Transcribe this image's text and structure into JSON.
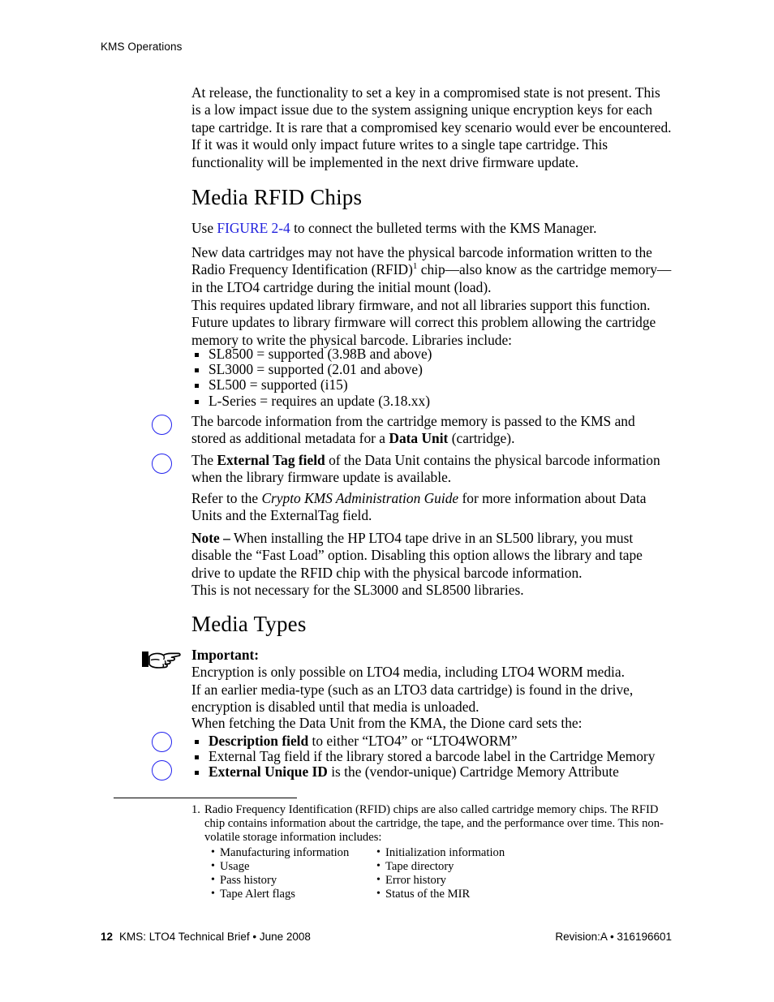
{
  "header": {
    "running_head": "KMS Operations"
  },
  "intro_paragraph": "At release, the functionality to set a key in a compromised state is not present. This is a low impact issue due to the system assigning unique encryption keys for each tape cartridge. It is rare that a compromised key scenario would ever be encountered. If it was it would only impact future writes to a single tape cartridge. This functionality will be implemented in the next drive firmware update.",
  "section_rfid": {
    "heading": "Media RFID Chips",
    "use_figure_prefix": "Use ",
    "figure_link": "FIGURE 2-4",
    "use_figure_suffix": " to connect the bulleted terms with the KMS Manager.",
    "para_new_cartridges_1": "New data cartridges may not have the physical barcode information written to the Radio Frequency Identification (RFID)",
    "footnote_marker": "1",
    "para_new_cartridges_2": " chip—also know as the cartridge memory—in the LTO4 cartridge during the initial mount (load).",
    "para_firmware": "This requires updated library firmware, and not all libraries support this function. Future updates to library firmware will correct this problem allowing the cartridge memory to write the physical barcode.  Libraries include:",
    "library_bullets": [
      "SL8500 = supported (3.98B and above)",
      "SL3000 = supported (2.01 and above)",
      "SL500 = supported (i15)",
      "L-Series = requires an update (3.18.xx)"
    ],
    "annotated_1_part1": "The barcode information from the cartridge memory is passed to the KMS and stored as additional metadata for a ",
    "annotated_1_bold": "Data Unit",
    "annotated_1_part2": " (cartridge).",
    "annotated_2_part1": "The ",
    "annotated_2_bold": "External Tag field",
    "annotated_2_part2": " of the Data Unit contains the physical barcode information when the library firmware update is available.",
    "refer_part1": "Refer to the ",
    "refer_italic": "Crypto KMS Administration Guide",
    "refer_part2": " for more information about Data Units and the ExternalTag field.",
    "note_label": "Note –",
    "note_body": " When installing the HP LTO4 tape drive in an SL500 library, you must disable the “Fast Load” option. Disabling this option allows the library and tape drive to update the RFID chip with the physical barcode information.",
    "note_body_line2": "This is not necessary for the SL3000 and SL8500 libraries."
  },
  "section_media_types": {
    "heading": "Media Types",
    "important_label": "Important:",
    "important_line_1": "Encryption is only possible on LTO4 media, including LTO4 WORM media.",
    "important_line_2": "If an earlier media-type (such as an LTO3 data cartridge) is found in the drive,",
    "important_line_3": "encryption is disabled until that media is unloaded.",
    "intro": "When fetching the Data Unit from the KMA, the Dione card sets the:",
    "bullets": [
      {
        "bold": "Description field",
        "rest": " to either “LTO4” or “LTO4WORM”"
      },
      {
        "bold": "",
        "rest": "External Tag field if the library stored a barcode label in the Cartridge Memory"
      },
      {
        "bold": "External Unique ID",
        "rest": " is the (vendor-unique) Cartridge Memory Attribute"
      }
    ]
  },
  "footnote": {
    "number": "1.",
    "text": "Radio Frequency Identification (RFID) chips are also called cartridge memory chips. The RFID chip contains information about the cartridge, the tape, and the performance over time. This non-volatile storage information includes:",
    "column_left": [
      "Manufacturing information",
      "Usage",
      "Pass history",
      "Tape Alert flags"
    ],
    "column_right": [
      "Initialization information",
      "Tape directory",
      "Error history",
      "Status of the MIR"
    ]
  },
  "footer": {
    "page_number": "12",
    "left_text": "KMS: LTO4 Technical Brief  •  June 2008",
    "right_text": "Revision:A  •  316196601"
  },
  "icons": {
    "manicule": "pointing-hand",
    "annotation_circle_color": "#2222ee",
    "link_color": "#2222dd"
  }
}
